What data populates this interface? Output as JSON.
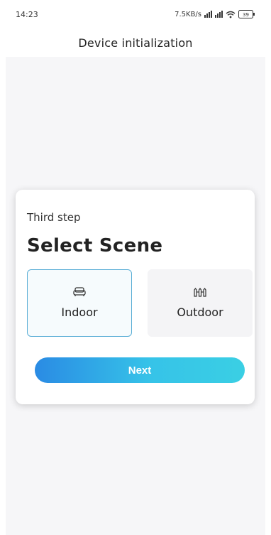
{
  "status_bar": {
    "time": "14:23",
    "network_speed": "7.5KB/s",
    "battery": "39",
    "icons": [
      "signal-icon",
      "signal-icon",
      "wifi-icon",
      "battery-icon"
    ]
  },
  "header": {
    "title": "Device initialization"
  },
  "card": {
    "step_label": "Third step",
    "heading": "Select Scene",
    "options": [
      {
        "label": "Indoor",
        "icon": "sofa-icon",
        "selected": true
      },
      {
        "label": "Outdoor",
        "icon": "fence-icon",
        "selected": false
      }
    ],
    "next_label": "Next"
  },
  "colors": {
    "selected_border": "#5aaed6",
    "button_gradient_start": "#2a8be4",
    "button_gradient_end": "#3acfe4",
    "background": "#f6f6f8"
  }
}
